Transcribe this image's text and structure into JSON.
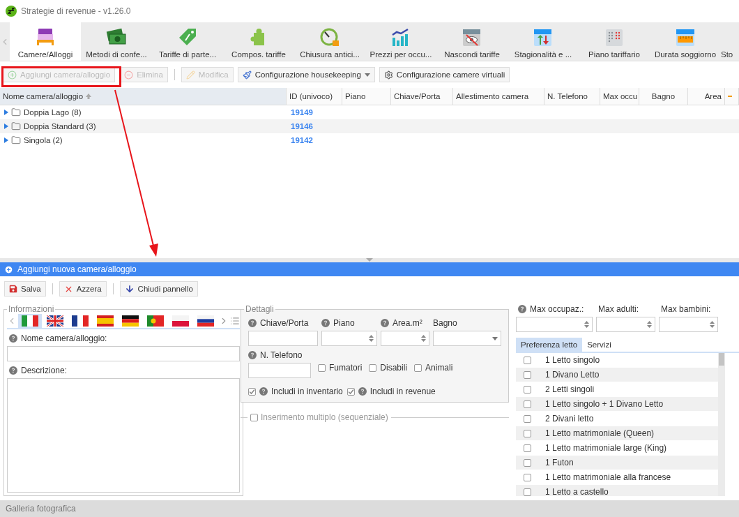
{
  "window": {
    "title": "Strategie di revenue - v1.26.0"
  },
  "ribbon_tabs": [
    {
      "label": "Camere/Alloggi",
      "selected": true
    },
    {
      "label": "Metodi di confe...",
      "selected": false
    },
    {
      "label": "Tariffe di parte...",
      "selected": false
    },
    {
      "label": "Compos. tariffe",
      "selected": false
    },
    {
      "label": "Chiusura antici...",
      "selected": false
    },
    {
      "label": "Prezzi per occu...",
      "selected": false
    },
    {
      "label": "Nascondi tariffe",
      "selected": false
    },
    {
      "label": "Stagionalità e ...",
      "selected": false
    },
    {
      "label": "Piano tariffario",
      "selected": false
    },
    {
      "label": "Durata soggiorno",
      "selected": false
    },
    {
      "label": "Sto",
      "selected": false
    }
  ],
  "toolbar": [
    {
      "label": "Aggiungi camera/alloggio",
      "kind": "button",
      "disabled": true
    },
    {
      "label": "Elimina",
      "kind": "button",
      "disabled": true
    },
    {
      "label": "Modifica",
      "kind": "button",
      "disabled": true
    },
    {
      "label": "Configurazione housekeeping",
      "kind": "dropdown",
      "disabled": false
    },
    {
      "label": "Configurazione camere virtuali",
      "kind": "button",
      "disabled": false
    }
  ],
  "table": {
    "columns": [
      "Nome camera/alloggio",
      "ID (univoco)",
      "Piano",
      "Chiave/Porta",
      "Allestimento camera",
      "N. Telefono",
      "Max occu",
      "Bagno",
      "Area"
    ],
    "rows": [
      {
        "name": "Doppia Lago (8)",
        "id": "19149",
        "expanded": false
      },
      {
        "name": "Doppia Standard (3)",
        "id": "19146",
        "expanded": false
      },
      {
        "name": "Singola (2)",
        "id": "19142",
        "expanded": false
      }
    ]
  },
  "panel": {
    "title": "Aggiungi nuova camera/alloggio",
    "buttons": [
      "Salva",
      "Azzera",
      "Chiudi pannello"
    ]
  },
  "info": {
    "legend": "Informazioni",
    "languages": [
      {
        "kind": "italy",
        "selected": true
      },
      {
        "kind": "uk",
        "selected": false
      },
      {
        "kind": "france",
        "selected": false
      },
      {
        "kind": "spain",
        "selected": false
      },
      {
        "kind": "germany",
        "selected": false
      },
      {
        "kind": "portugal",
        "selected": false
      },
      {
        "kind": "poland",
        "selected": false
      },
      {
        "kind": "russia",
        "selected": false
      }
    ],
    "name_label": "Nome camera/alloggio:",
    "description_label": "Descrizione:"
  },
  "details": {
    "legend": "Dettagli",
    "fields": [
      {
        "label": "Chiave/Porta",
        "kind": "text",
        "help": true
      },
      {
        "label": "Piano",
        "kind": "spin",
        "help": true
      },
      {
        "label": "Area.m²",
        "kind": "spin",
        "help": true
      },
      {
        "label": "Bagno",
        "kind": "select",
        "help": false
      }
    ],
    "phone_label": "N. Telefono",
    "features": [
      {
        "label": "Fumatori",
        "checked": false
      },
      {
        "label": "Disabili",
        "checked": false
      },
      {
        "label": "Animali",
        "checked": false
      }
    ],
    "includes": [
      {
        "label": "Includi in inventario",
        "checked": true
      },
      {
        "label": "Includi in revenue",
        "checked": true
      }
    ]
  },
  "multiple": {
    "label": "Inserimento multiplo (sequenziale)",
    "checked": false
  },
  "capacity": [
    {
      "label": "Max occupaz.:",
      "help": true
    },
    {
      "label": "Max adulti:",
      "help": false
    },
    {
      "label": "Max bambini:",
      "help": false
    }
  ],
  "bed_tabs": [
    {
      "label": "Preferenza letto",
      "selected": true
    },
    {
      "label": "Servizi",
      "selected": false
    }
  ],
  "beds": [
    {
      "label": "1 Letto singolo",
      "checked": false
    },
    {
      "label": "1 Divano Letto",
      "checked": false
    },
    {
      "label": "2 Letti singoli",
      "checked": false
    },
    {
      "label": "1 Letto singolo + 1 Divano Letto",
      "checked": false
    },
    {
      "label": "2 Divani letto",
      "checked": false
    },
    {
      "label": "1 Letto matrimoniale (Queen)",
      "checked": false
    },
    {
      "label": "1 Letto matrimoniale large (King)",
      "checked": false
    },
    {
      "label": "1 Futon",
      "checked": false
    },
    {
      "label": "1 Letto matrimoniale alla francese",
      "checked": false
    },
    {
      "label": "1 Letto a castello",
      "checked": false
    }
  ],
  "gallery": {
    "title": "Galleria fotografica"
  }
}
